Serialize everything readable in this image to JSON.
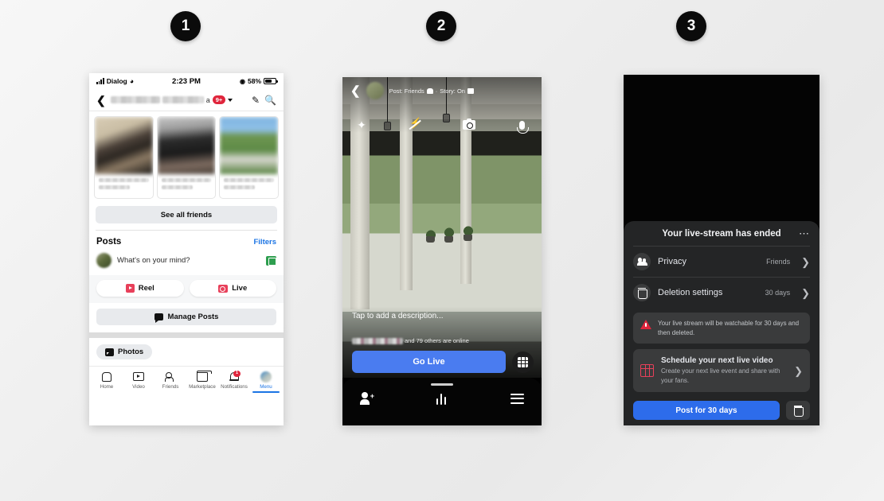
{
  "steps": [
    {
      "number": "1"
    },
    {
      "number": "2"
    },
    {
      "number": "3"
    }
  ],
  "colors": {
    "accent_blue": "#1b74e4",
    "live_red": "#e8405a",
    "badge_red": "#e0253c",
    "go_live_blue": "#4a7cf0",
    "post_blue": "#2d6ceb",
    "sheet_dark": "#242526",
    "row_dark": "#3a3b3c"
  },
  "phone1": {
    "status_bar": {
      "carrier": "Dialog",
      "wifi_icon": "wifi-icon",
      "time": "2:23 PM",
      "location_icon": "location-arrow-icon",
      "battery_percent": "58%",
      "battery_icon": "battery-icon"
    },
    "topbar": {
      "back_icon": "chevron-left-icon",
      "name_redacted": "",
      "name_suffix": "a",
      "notification_badge": "9+",
      "caret_icon": "chevron-down-icon",
      "edit_icon": "pencil-icon",
      "search_icon": "search-icon"
    },
    "friend_cards": [
      {
        "name_redacted": "",
        "sub_redacted": ""
      },
      {
        "name_redacted": "",
        "sub_redacted": ""
      },
      {
        "name_redacted": "",
        "sub_redacted": ""
      }
    ],
    "see_all_friends": "See all friends",
    "posts": {
      "heading": "Posts",
      "filters_link": "Filters",
      "composer_placeholder": "What's on your mind?",
      "composer_photo_icon": "photo-icon",
      "chips": [
        {
          "label": "Reel",
          "icon": "reel-icon"
        },
        {
          "label": "Live",
          "icon": "live-icon"
        }
      ],
      "manage_posts": "Manage Posts",
      "manage_icon": "speech-bubble-icon"
    },
    "photos_chip": {
      "label": "Photos",
      "icon": "photos-icon"
    },
    "tabbar": [
      {
        "label": "Home",
        "icon": "home-icon",
        "active": false,
        "badge": ""
      },
      {
        "label": "Video",
        "icon": "video-icon",
        "active": false,
        "badge": ""
      },
      {
        "label": "Friends",
        "icon": "friends-icon",
        "active": false,
        "badge": ""
      },
      {
        "label": "Marketplace",
        "icon": "marketplace-icon",
        "active": false,
        "badge": ""
      },
      {
        "label": "Notifications",
        "icon": "bell-icon",
        "active": false,
        "badge": "1"
      },
      {
        "label": "Menu",
        "icon": "avatar-icon",
        "active": true,
        "badge": ""
      }
    ]
  },
  "phone2": {
    "back_icon": "chevron-left-icon",
    "avatar": "avatar-icon",
    "name_redacted": "",
    "subtitle_post": "Post: Friends",
    "subtitle_people_icon": "people-icon",
    "subtitle_sep": "·",
    "subtitle_story": "Story: On",
    "subtitle_story_icon": "story-icon",
    "tools": [
      {
        "icon": "effects-magic-wand-icon"
      },
      {
        "icon": "flash-off-icon"
      },
      {
        "icon": "flip-camera-icon"
      },
      {
        "icon": "microphone-icon"
      }
    ],
    "description_placeholder": "Tap to add a description...",
    "online_name_redacted": "",
    "online_text": "and 79 others are online",
    "go_live_label": "Go Live",
    "keypad_icon": "grid-keypad-icon",
    "bottom_nav": [
      {
        "icon": "add-person-icon"
      },
      {
        "icon": "bar-chart-icon"
      },
      {
        "icon": "hamburger-menu-icon"
      }
    ]
  },
  "phone3": {
    "sheet_title": "Your live-stream has ended",
    "overflow_icon": "more-horizontal-icon",
    "rows": [
      {
        "icon": "people-icon",
        "label": "Privacy",
        "value": "Friends",
        "chevron": "chevron-right-icon"
      },
      {
        "icon": "trash-icon",
        "label": "Deletion settings",
        "value": "30 days",
        "chevron": "chevron-right-icon"
      }
    ],
    "alert": {
      "icon": "warning-triangle-icon",
      "text": "Your live stream will be watchable for 30 days and then deleted."
    },
    "schedule_card": {
      "icon": "calendar-icon",
      "title": "Schedule your next live video",
      "subtitle": "Create your next live event and share with your fans.",
      "chevron": "chevron-right-icon"
    },
    "post_button": "Post for 30 days",
    "delete_icon": "trash-icon"
  }
}
